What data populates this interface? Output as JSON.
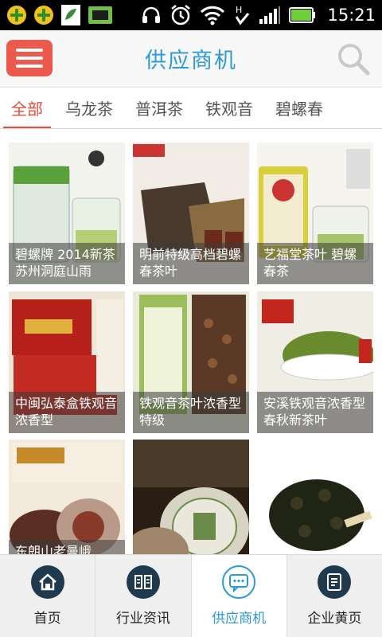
{
  "status_bar": {
    "time": "15:21",
    "battery_icon": "battery-icon",
    "signal_icon": "signal-icon",
    "wifi_icon": "wifi-icon"
  },
  "header": {
    "title": "供应商机",
    "menu_icon": "menu-icon",
    "search_icon": "search-icon"
  },
  "tabs": [
    {
      "label": "全部"
    },
    {
      "label": "乌龙茶"
    },
    {
      "label": "普洱茶"
    },
    {
      "label": "铁观音"
    },
    {
      "label": "碧螺春"
    }
  ],
  "products": [
    {
      "caption": "碧螺牌 2014新茶苏州洞庭山雨"
    },
    {
      "caption": "明前特级高档碧螺春茶叶"
    },
    {
      "caption": "艺福堂茶叶 碧螺春茶"
    },
    {
      "caption": "中闽弘泰盒铁观音浓香型"
    },
    {
      "caption": "铁观音茶叶浓香型特级"
    },
    {
      "caption": "安溪铁观音浓香型春秋新茶叶"
    },
    {
      "caption": "东朗山老曼峨"
    },
    {
      "caption": ""
    },
    {
      "caption": ""
    }
  ],
  "bottom_nav": [
    {
      "label": "首页",
      "icon": "home-icon"
    },
    {
      "label": "行业资讯",
      "icon": "news-icon"
    },
    {
      "label": "供应商机",
      "icon": "chat-icon"
    },
    {
      "label": "企业黄页",
      "icon": "directory-icon"
    }
  ],
  "colors": {
    "accent_blue": "#2c9ad6",
    "accent_red": "#e84b3c",
    "menu_red": "#ec5a4e",
    "nav_dark": "#1f3a4e"
  }
}
